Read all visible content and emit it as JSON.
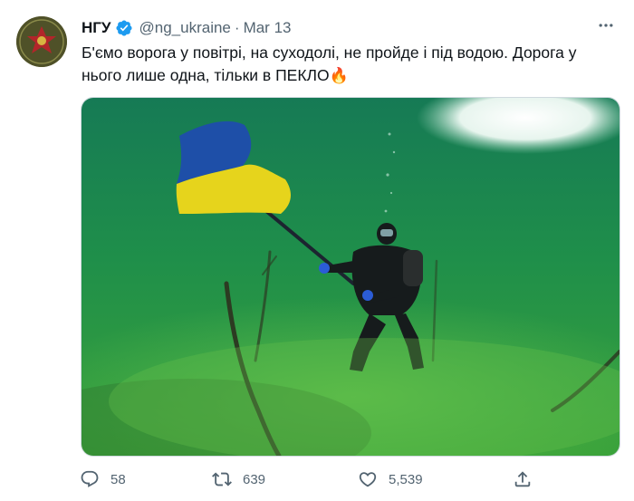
{
  "account": {
    "name": "НГУ",
    "handle": "@ng_ukraine",
    "separator": "·",
    "date": "Mar 13"
  },
  "tweet": {
    "text": "Б'ємо ворога у повітрі, на суходолі, не пройде і під водою. Дорога у нього лише одна, тільки в ПЕКЛО",
    "emoji": "🔥"
  },
  "metrics": {
    "replies": "58",
    "retweets": "639",
    "likes": "5,539"
  },
  "colors": {
    "verified": "#1d9bf0",
    "flag_blue": "#1e4fa8",
    "flag_yellow": "#e6d41c",
    "water": "#1f8f4a"
  },
  "icons": [
    "verified-badge-icon",
    "more-icon",
    "reply-icon",
    "retweet-icon",
    "like-icon",
    "share-icon"
  ]
}
